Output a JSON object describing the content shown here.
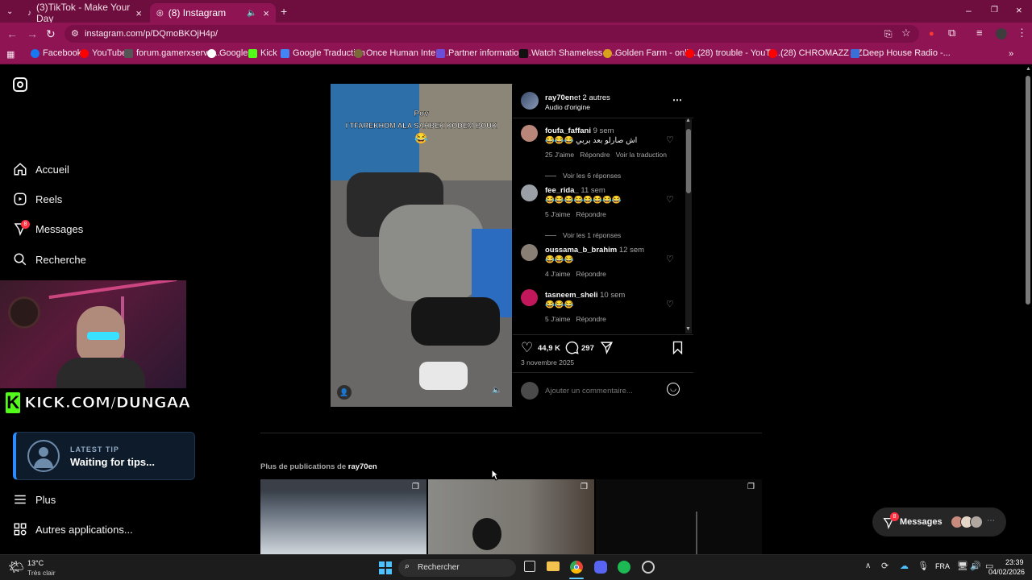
{
  "browser": {
    "tabs": [
      {
        "label": "(3)TikTok - Make Your Day",
        "active": false
      },
      {
        "label": "(8) Instagram",
        "active": true
      }
    ],
    "url": "instagram.com/p/DQmoBKOjH4p/",
    "bookmarks": [
      "Facebook",
      "YouTube",
      "forum.gamerxserver...",
      "Google",
      "Kick",
      "Google Traduction",
      "Once Human Intera...",
      "Partner information...",
      "Watch Shameless T...",
      "Golden Farm - onlin...",
      "(28) trouble - YouTu...",
      "(28) CHROMAZZ - Z...",
      "Deep House Radio -..."
    ]
  },
  "sidebar": {
    "items": [
      {
        "label": "Accueil",
        "icon": "home-icon"
      },
      {
        "label": "Reels",
        "icon": "reels-icon"
      },
      {
        "label": "Messages",
        "icon": "messenger-icon",
        "badge": "8"
      },
      {
        "label": "Recherche",
        "icon": "search-icon"
      }
    ],
    "more": "Plus",
    "apps": "Autres applications..."
  },
  "overlay": {
    "kick_text": "KICK.COM/DUNGAA",
    "tip_title": "LATEST TIP",
    "tip_text": "Waiting for tips..."
  },
  "post": {
    "video_caption_1": "Pov",
    "video_caption_2": "I TFAREKHOM ALA SAHBEK KODEM BOUK",
    "video_caption_3": "😂",
    "author": "ray70en",
    "author_suffix": "et 2 autres",
    "audio": "Audio d'origine",
    "comments": [
      {
        "user": "foufa_faffani",
        "time": "9 sem",
        "text": "😂😂😂 اش صارلو بعد بربي",
        "likes": "25 J'aime",
        "reply": "Répondre",
        "translate": "Voir la traduction"
      },
      {
        "user": "fee_rida_",
        "time": "11 sem",
        "text": "😂😂😂😂😂😂😂😂",
        "likes": "5 J'aime",
        "reply": "Répondre"
      },
      {
        "user": "oussama_b_brahim",
        "time": "12 sem",
        "text": "😂😂😂",
        "likes": "4 J'aime",
        "reply": "Répondre"
      },
      {
        "user": "tasneem_sheli",
        "time": "10 sem",
        "text": "😂😂😂",
        "likes": "5 J'aime",
        "reply": "Répondre"
      }
    ],
    "view_replies_1": "Voir les 6 réponses",
    "view_replies_2": "Voir les 1 réponses",
    "like_count": "44,9 K",
    "comment_count": "297",
    "date": "3 novembre 2025",
    "add_comment_placeholder": "Ajouter un commentaire..."
  },
  "more_posts": {
    "label": "Plus de publications de",
    "user": "ray70en"
  },
  "messages_pill": {
    "label": "Messages",
    "badge": "8"
  },
  "taskbar": {
    "weather_temp": "13°C",
    "weather_desc": "Très clair",
    "search_label": "Rechercher",
    "lang": "FRA",
    "time": "23:39",
    "date": "04/02/2026"
  },
  "colors": {
    "chrome_frame": "#6e0e3e",
    "chrome_toolbar": "#8f1454",
    "ig_background": "#000000",
    "kick_green": "#53fc18"
  }
}
